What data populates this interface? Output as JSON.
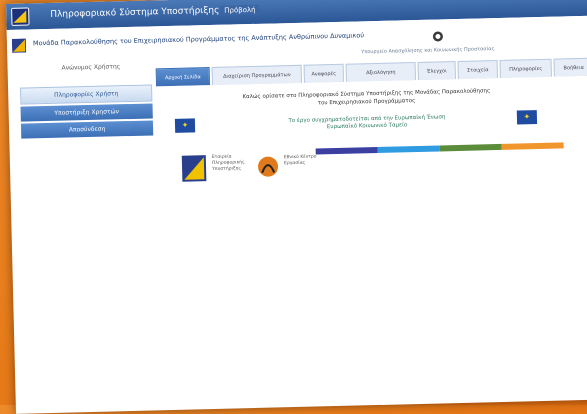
{
  "titlebar": {
    "title": "Πληροφοριακό Σύστημα Υποστήριξης",
    "menu": "Πρόβολή"
  },
  "header": {
    "title": "Μονάδα Παρακολούθησης του Επιχειρησιακού Προγράμματος της Ανάπτυξης Ανθρώπινου Δυναμικού",
    "subtitle": "Υπουργείο Απασχόλησης και Κοινωνικής Προστασίας",
    "user": "Ανώνυμος Χρήστης"
  },
  "sidebar": {
    "items": [
      {
        "label": "Πληροφορίες Χρήστη"
      },
      {
        "label": "Υποστήριξη Χρηστών"
      },
      {
        "label": "Αποσύνδεση"
      }
    ]
  },
  "tabs": [
    {
      "label": "Αρχική Σελίδα"
    },
    {
      "label": "Διαχείριση Προγραμμάτων"
    },
    {
      "label": "Αναφορές"
    },
    {
      "label": "Αξιολόγηση"
    },
    {
      "label": "Έλεγχοι"
    },
    {
      "label": "Στοιχεία"
    },
    {
      "label": "Πληροφορίες"
    },
    {
      "label": "Βοήθεια"
    }
  ],
  "content": {
    "welcome_line1": "Καλώς ορίσατε στο Πληροφοριακό Σύστημα Υποστήριξης της Μονάδας Παρακολούθησης",
    "welcome_line2": "του Επιχειρησιακού Προγράμματος",
    "eu_line1": "Το έργο συγχρηματοδοτείται από την Ευρωπαϊκή Ένωση",
    "eu_line2": "Ευρωπαϊκό Κοινωνικό Ταμείο",
    "partner1": "Εταιρεία Πληροφορικής Υποστήριξης",
    "partner2": "Εθνικό Κέντρο Εργασίας"
  },
  "colors": {
    "accent": "#3c6fb5",
    "strip": [
      "#3a3fa0",
      "#2f9be0",
      "#5b8c3a",
      "#f0962c"
    ]
  }
}
